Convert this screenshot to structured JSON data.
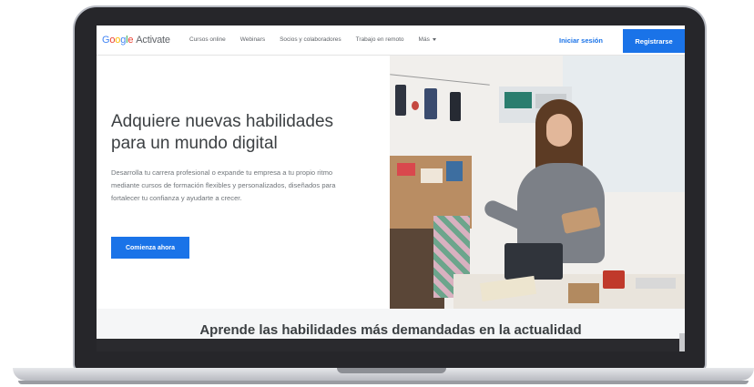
{
  "navbar": {
    "logo_google": [
      "G",
      "o",
      "o",
      "g",
      "l",
      "e"
    ],
    "logo_product": "Activate",
    "links": [
      "Cursos online",
      "Webinars",
      "Socios y colaboradores",
      "Trabajo en remoto"
    ],
    "more_label": "Más",
    "signin_label": "Iniciar sesión",
    "register_label": "Registrarse"
  },
  "hero": {
    "title_line1": "Adquiere nuevas habilidades",
    "title_line2": "para un mundo digital",
    "description": "Desarrolla tu carrera profesional o expande tu empresa a tu propio ritmo mediante cursos de formación flexibles y personalizados, diseñados para fortalecer tu confianza y ayudarte a crecer.",
    "cta_label": "Comienza ahora"
  },
  "section": {
    "heading": "Aprende las habilidades más demandadas en la actualidad"
  },
  "colors": {
    "brand_blue": "#1a73e8",
    "laptop_frame": "#26262a"
  }
}
